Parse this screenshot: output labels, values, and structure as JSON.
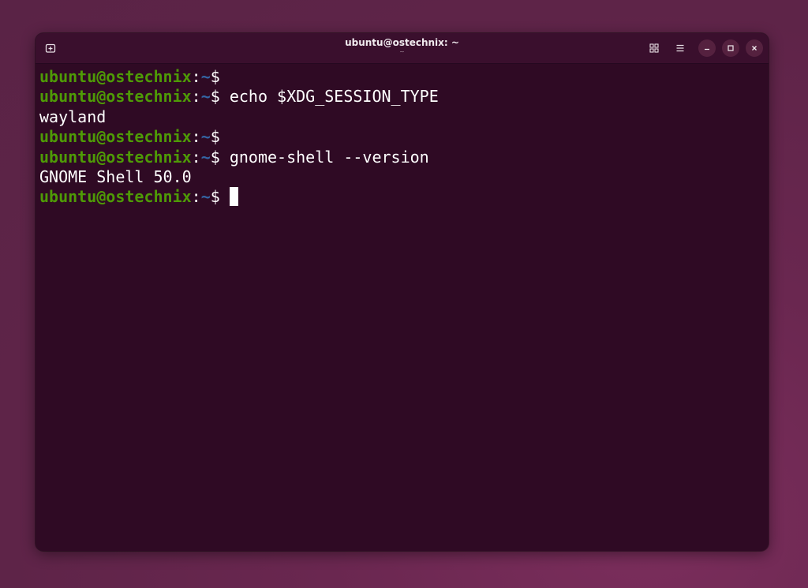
{
  "window": {
    "title": "ubuntu@ostechnix: ~",
    "subtitle": "~"
  },
  "colors": {
    "terminal_bg": "#2f0a24",
    "prompt_user": "#4e9a06",
    "prompt_path": "#3465a4",
    "text": "#ffffff"
  },
  "icons": {
    "new_tab": "new-tab-icon",
    "view": "grid-view-icon",
    "menu": "hamburger-menu-icon",
    "minimize": "minimize-icon",
    "maximize": "maximize-icon",
    "close": "close-icon"
  },
  "prompt": {
    "user_host": "ubuntu@ostechnix",
    "colon": ":",
    "path": "~",
    "symbol": "$"
  },
  "lines": [
    {
      "type": "prompt",
      "command": ""
    },
    {
      "type": "prompt",
      "command": "echo $XDG_SESSION_TYPE"
    },
    {
      "type": "output",
      "text": "wayland"
    },
    {
      "type": "prompt",
      "command": ""
    },
    {
      "type": "prompt",
      "command": "gnome-shell --version"
    },
    {
      "type": "output",
      "text": "GNOME Shell 50.0"
    },
    {
      "type": "prompt",
      "command": "",
      "cursor": true
    }
  ]
}
